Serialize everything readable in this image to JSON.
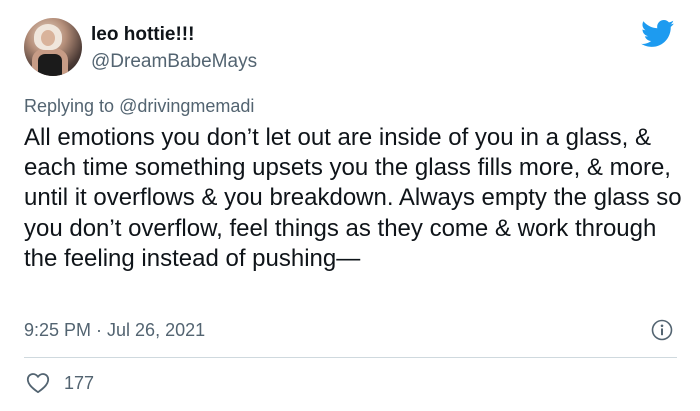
{
  "author": {
    "display_name": "leo hottie!!!",
    "handle": "@DreamBabeMays"
  },
  "reply": {
    "prefix": "Replying to",
    "mention": "@drivingmemadi"
  },
  "tweet": {
    "text": "All emotions you don’t let out are inside of you in a glass, & each time something upsets you the glass fills more, & more, until it overflows & you breakdown. Always empty the glass so you don’t overflow, feel things as they come & work through the feeling instead of pushing—",
    "timestamp": "9:25 PM · Jul 26, 2021"
  },
  "engagement": {
    "likes": "177"
  },
  "icons": {
    "brand": "twitter-bird-icon",
    "info": "info-icon",
    "like": "heart-icon"
  },
  "colors": {
    "brand_blue": "#1d9bf0",
    "secondary_text": "#536471",
    "primary_text": "#0f1419",
    "divider": "#cfd9de"
  }
}
